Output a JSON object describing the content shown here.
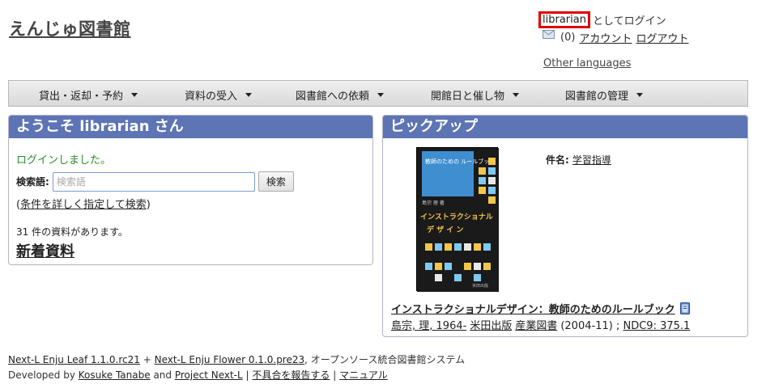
{
  "header": {
    "site_title": "えんじゅ図書館",
    "username": "librarian",
    "login_suffix": "としてログイン",
    "mail_count": "(0)",
    "account_link": "アカウント",
    "logout_link": "ログアウト",
    "other_languages": "Other languages"
  },
  "nav": {
    "items": [
      {
        "label": "貸出・返却・予約"
      },
      {
        "label": "資料の受入"
      },
      {
        "label": "図書館への依頼"
      },
      {
        "label": "開館日と催し物"
      },
      {
        "label": "図書館の管理"
      }
    ]
  },
  "welcome": {
    "heading": "ようこそ librarian さん",
    "flash": "ログインしました。",
    "search_label": "検索語:",
    "search_placeholder": "検索語",
    "search_value": "",
    "search_button": "検索",
    "adv_open": "(",
    "adv_link": "条件を詳しく指定して検索",
    "adv_close": ")",
    "count_text": "31 件の資料があります。",
    "new_items": "新着資料"
  },
  "pickup": {
    "heading": "ピックアップ",
    "subject_label": "件名:",
    "subject_value": "学習指導",
    "book_title": "インストラクショナルデザイン：教師のためのルールブック",
    "author": "島宗, 理, 1964-",
    "publisher1": "米田出版",
    "publisher2": "産業図書",
    "date": "(2004-11)",
    "sep": ";",
    "ndc": "NDC9: 375.1",
    "cover": {
      "top_text": "教師のための ルールブック",
      "main_text1": "インストラクショナル",
      "main_text2": "デ ザ イ ン",
      "author_text": "島宗 理 著",
      "publisher_text": "米田出版"
    }
  },
  "footer": {
    "leaf": "Next-L Enju Leaf 1.1.0.rc21",
    "plus": "+",
    "flower": "Next-L Enju Flower 0.1.0.pre23",
    "tagline": ", オープンソース統合図書館システム",
    "developed_by": "Developed by",
    "dev1": "Kosuke Tanabe",
    "and": "and",
    "dev2": "Project Next-L",
    "sep": "|",
    "report": "不具合を報告する",
    "manual": "マニュアル"
  },
  "colors": {
    "panel_header": "#5d74b5",
    "flash_green": "#2a8a2a",
    "highlight_red": "#e00000"
  }
}
